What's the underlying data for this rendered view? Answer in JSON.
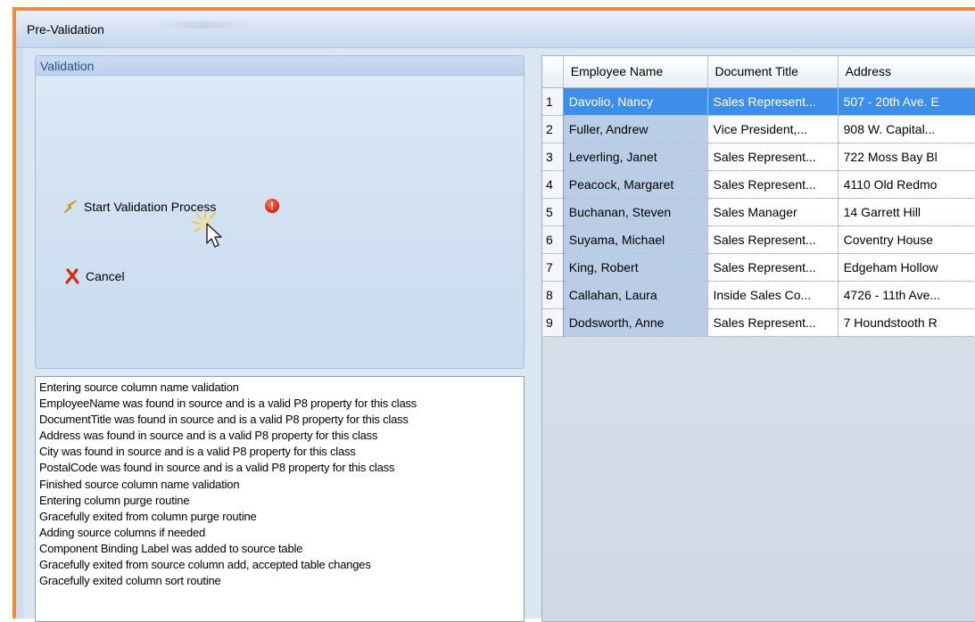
{
  "window": {
    "title": "Pre-Validation"
  },
  "validation": {
    "group_label": "Validation",
    "start_label": "Start Validation Process",
    "cancel_label": "Cancel"
  },
  "log": {
    "lines": [
      "Entering source column name validation",
      "EmployeeName was found in source and is a valid P8 property for this class",
      "DocumentTitle was found in source and is a valid P8 property for this class",
      "Address was found in source and is a valid P8 property for this class",
      "City was found in source and is a valid P8 property for this class",
      "PostalCode was found in source and is a valid P8 property for this class",
      "Finished source column name validation",
      "Entering column purge routine",
      "Gracefully exited from column purge routine",
      "Adding source columns if needed",
      "Component Binding Label was added to source table",
      "Gracefully exited from source column add, accepted table changes",
      "Gracefully exited column sort routine"
    ]
  },
  "grid": {
    "columns": [
      "Employee Name",
      "Document Title",
      "Address"
    ],
    "rows": [
      {
        "num": "1",
        "name": "Davolio, Nancy",
        "title": "Sales Represent...",
        "address": "507 - 20th Ave. E"
      },
      {
        "num": "2",
        "name": "Fuller, Andrew",
        "title": "Vice President,...",
        "address": "908 W. Capital..."
      },
      {
        "num": "3",
        "name": "Leverling, Janet",
        "title": "Sales Represent...",
        "address": "722 Moss Bay Bl"
      },
      {
        "num": "4",
        "name": "Peacock, Margaret",
        "title": "Sales Represent...",
        "address": "4110 Old Redmo"
      },
      {
        "num": "5",
        "name": "Buchanan, Steven",
        "title": "Sales Manager",
        "address": "14 Garrett Hill"
      },
      {
        "num": "6",
        "name": "Suyama, Michael",
        "title": "Sales Represent...",
        "address": "Coventry House"
      },
      {
        "num": "7",
        "name": "King, Robert",
        "title": "Sales Represent...",
        "address": "Edgeham Hollow"
      },
      {
        "num": "8",
        "name": "Callahan, Laura",
        "title": "Inside Sales Co...",
        "address": "4726 - 11th Ave..."
      },
      {
        "num": "9",
        "name": "Dodsworth, Anne",
        "title": "Sales Represent...",
        "address": "7 Houndstooth R"
      }
    ],
    "selected_row": "1"
  },
  "icons": {
    "start": "lightning-bolt-icon",
    "cancel": "red-x-icon",
    "warning": "error-exclamation-icon",
    "cursor": "mouse-pointer-icon"
  },
  "colors": {
    "frame_border": "#f08a3e",
    "selection": "#3d8ee8",
    "name_column": "#b9cde6",
    "warning": "#d9200c"
  }
}
